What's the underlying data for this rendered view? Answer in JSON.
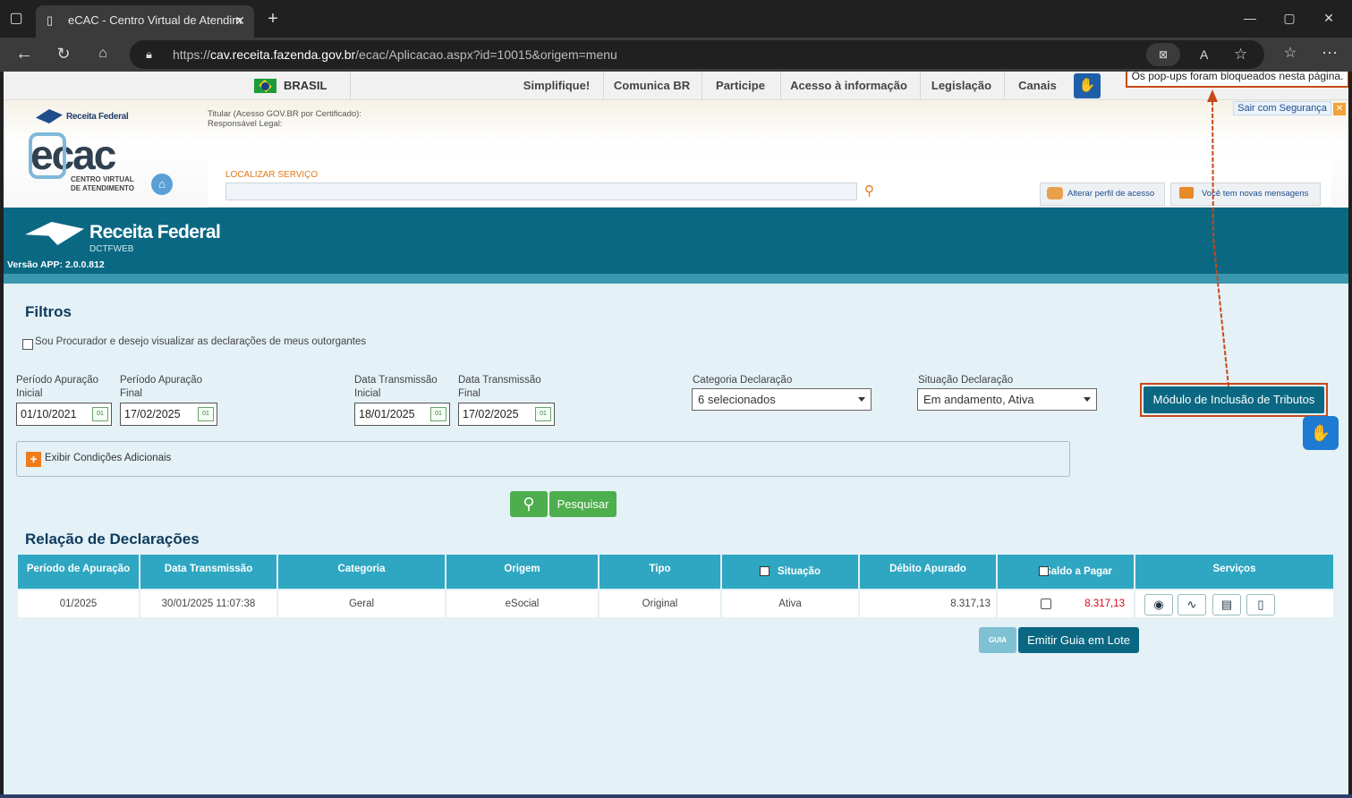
{
  "browser": {
    "tab_title": "eCAC - Centro Virtual de Atendim",
    "url_prefix": "https://",
    "url_host": "cav.receita.fazenda.gov.br",
    "url_path": "/ecac/Aplicacao.aspx?id=10015&origem=menu"
  },
  "govbar": {
    "country": "BRASIL",
    "items": [
      "Simplifique!",
      "Comunica BR",
      "Participe",
      "Acesso à informação",
      "Legislação",
      "Canais"
    ],
    "popup_notice": "Os pop-ups foram bloqueados nesta página."
  },
  "header": {
    "rf_small": "Receita Federal",
    "titular_label": "Titular (Acesso GOV.BR por Certificado):",
    "responsavel_label": "Responsável Legal:",
    "ecac_logo": "ecac",
    "ecac_sub1": "CENTRO VIRTUAL",
    "ecac_sub2": "DE ATENDIMENTO",
    "sair": "Sair com Segurança",
    "localizar_label": "LOCALIZAR SERVIÇO",
    "alterar_perfil": "Alterar perfil de acesso",
    "mensagens": "Você tem novas mensagens"
  },
  "rfbar": {
    "brand": "Receita Federal",
    "sub": "DCTFWEB",
    "version": "Versão APP: 2.0.0.812"
  },
  "filtros": {
    "title": "Filtros",
    "procurador": "Sou Procurador e desejo visualizar as declarações de meus outorgantes",
    "per_ini_1": "Período Apuração",
    "per_ini_2": "Inicial",
    "per_ini_val": "01/10/2021",
    "per_fin_1": "Período Apuração",
    "per_fin_2": "Final",
    "per_fin_val": "17/02/2025",
    "dt_ini_1": "Data Transmissão",
    "dt_ini_2": "Inicial",
    "dt_ini_val": "18/01/2025",
    "dt_fin_1": "Data Transmissão",
    "dt_fin_2": "Final",
    "dt_fin_val": "17/02/2025",
    "categoria_label": "Categoria Declaração",
    "categoria_val": "6 selecionados",
    "situacao_label": "Situação Declaração",
    "situacao_val": "Em andamento, Ativa",
    "modulo_btn": "Módulo de Inclusão de Tributos",
    "exibir": "Exibir Condições Adicionais",
    "pesquisar": "Pesquisar",
    "cal_icon_text": "01"
  },
  "relacao": {
    "title": "Relação de Declarações",
    "headers": [
      "Período de Apuração",
      "Data Transmissão",
      "Categoria",
      "Origem",
      "Tipo",
      "Situação",
      "Débito Apurado",
      "Saldo a Pagar",
      "Serviços"
    ],
    "row": [
      "01/2025",
      "30/01/2025 11:07:38",
      "Geral",
      "eSocial",
      "Original",
      "Ativa",
      "8.317,13",
      "8.317,13"
    ],
    "guia_icon": "GUIA",
    "emitir": "Emitir Guia em Lote"
  },
  "colors": {
    "header_blue": "#0b6883",
    "table_head": "#2fa7c2",
    "green": "#4cae4c",
    "saldo_red": "#d9001b",
    "annotation": "#c8481a"
  }
}
